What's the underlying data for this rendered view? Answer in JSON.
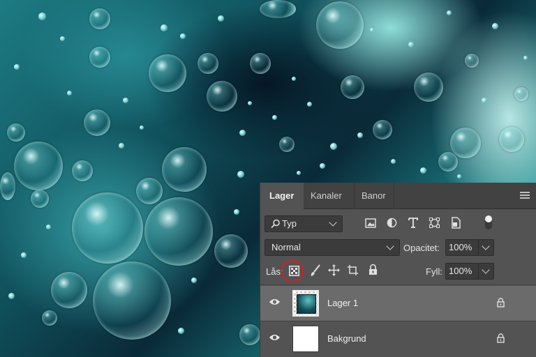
{
  "tabs": [
    {
      "label": "Lager",
      "active": true
    },
    {
      "label": "Kanaler",
      "active": false
    },
    {
      "label": "Banor",
      "active": false
    }
  ],
  "filter": {
    "label": "Typ",
    "icons": [
      "image-filter-icon",
      "adjustment-filter-icon",
      "type-filter-icon",
      "shape-filter-icon",
      "smart-object-filter-icon",
      "filter-toggle-icon"
    ]
  },
  "blend": {
    "mode": "Normal",
    "opacity_label": "Opacitet:",
    "opacity_value": "100%"
  },
  "lock": {
    "label": "Lås:",
    "fill_label": "Fyll:",
    "fill_value": "100%",
    "icons": [
      "lock-transparent-pixels-icon",
      "lock-image-pixels-icon",
      "lock-position-icon",
      "lock-artboard-icon",
      "lock-all-icon"
    ]
  },
  "layers": [
    {
      "name": "Lager 1",
      "selected": true,
      "visible": true,
      "locked": true
    },
    {
      "name": "Bakgrund",
      "selected": false,
      "visible": true,
      "locked": true
    }
  ],
  "colors": {
    "panel": "#535353",
    "tabbar": "#424242",
    "selected_row": "#6b6b6b",
    "highlight": "#d21f26"
  }
}
